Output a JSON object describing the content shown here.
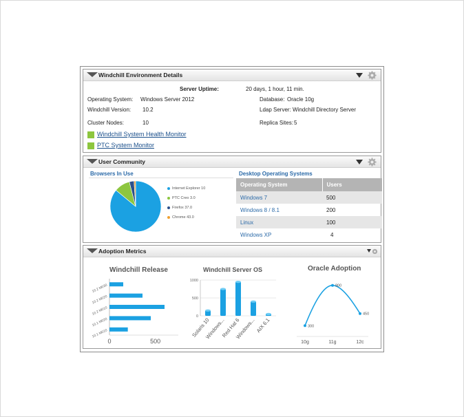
{
  "environment": {
    "title": "Windchill Environment Details",
    "uptime_label": "Server Uptime:",
    "uptime_value": "20 days, 1 hour, 11 min.",
    "os_label": "Operating System:",
    "os_value": "Windows Server 2012",
    "version_label": "Windchill Version:",
    "version_value": "10.2",
    "nodes_label": "Cluster Nodes:",
    "nodes_value": "10",
    "db_label": "Database:",
    "db_value": "Oracle 10g",
    "ldap_label": "Ldap Server:",
    "ldap_value": "Windchill Directory Server",
    "replica_label": "Replica Sites:",
    "replica_value": "5",
    "links": [
      "Windchill System Health Monitor",
      "PTC System Monitor"
    ]
  },
  "community": {
    "title": "User Community",
    "browsers_title": "Browsers In Use",
    "browsers_legend": [
      "Internet Explorer 10",
      "PTC Creo 3.0",
      "Firefox 37.0",
      "Chrome 43.0"
    ],
    "os_title": "Desktop Operating Systems",
    "os_headers": [
      "Operating System",
      "Users"
    ],
    "os_rows": [
      {
        "name": "Windows 7",
        "users": "500"
      },
      {
        "name": "Windows 8 / 8.1",
        "users": "200"
      },
      {
        "name": "Linux",
        "users": "100"
      },
      {
        "name": "Windows XP",
        "users": "4"
      }
    ]
  },
  "adoption": {
    "title": "Adoption Metrics",
    "release_title": "Windchill Release",
    "server_os_title": "Windchill Server OS",
    "oracle_title": "Oracle Adoption"
  },
  "colors": {
    "accent": "#1ba1e2",
    "green": "#8dc63f",
    "link": "#1a4f8b",
    "header_blue": "#2b6aa8"
  },
  "chart_data": [
    {
      "type": "pie",
      "title": "Browsers In Use",
      "categories": [
        "Internet Explorer 10",
        "PTC Creo 3.0",
        "Firefox 37.0",
        "Chrome 43.0"
      ],
      "values": [
        86,
        10,
        3,
        1
      ],
      "colors": [
        "#1ba1e2",
        "#8dc63f",
        "#2b4f8a",
        "#f0a030"
      ]
    },
    {
      "type": "bar",
      "orientation": "horizontal",
      "title": "Windchill Release",
      "categories": [
        "10.2 M030",
        "10.2 M020",
        "10.2 M010",
        "10.1 M020",
        "10.1 M010"
      ],
      "values": [
        150,
        360,
        600,
        450,
        200
      ],
      "xlim": [
        0,
        750
      ],
      "xticks": [
        0,
        500
      ]
    },
    {
      "type": "bar",
      "title": "Windchill Server OS",
      "categories": [
        "Solaris 10",
        "Windows...",
        "Red Hat 6",
        "Windows...",
        "AIX 6.1"
      ],
      "values": [
        150,
        750,
        950,
        400,
        50
      ],
      "ylim": [
        0,
        1000
      ],
      "yticks": [
        0,
        500,
        1000
      ]
    },
    {
      "type": "line",
      "title": "Oracle Adoption",
      "categories": [
        "10g",
        "11g",
        "12c"
      ],
      "values": [
        300,
        800,
        450
      ],
      "data_labels": [
        "300",
        "800",
        "450"
      ],
      "ylim": [
        200,
        900
      ]
    }
  ]
}
